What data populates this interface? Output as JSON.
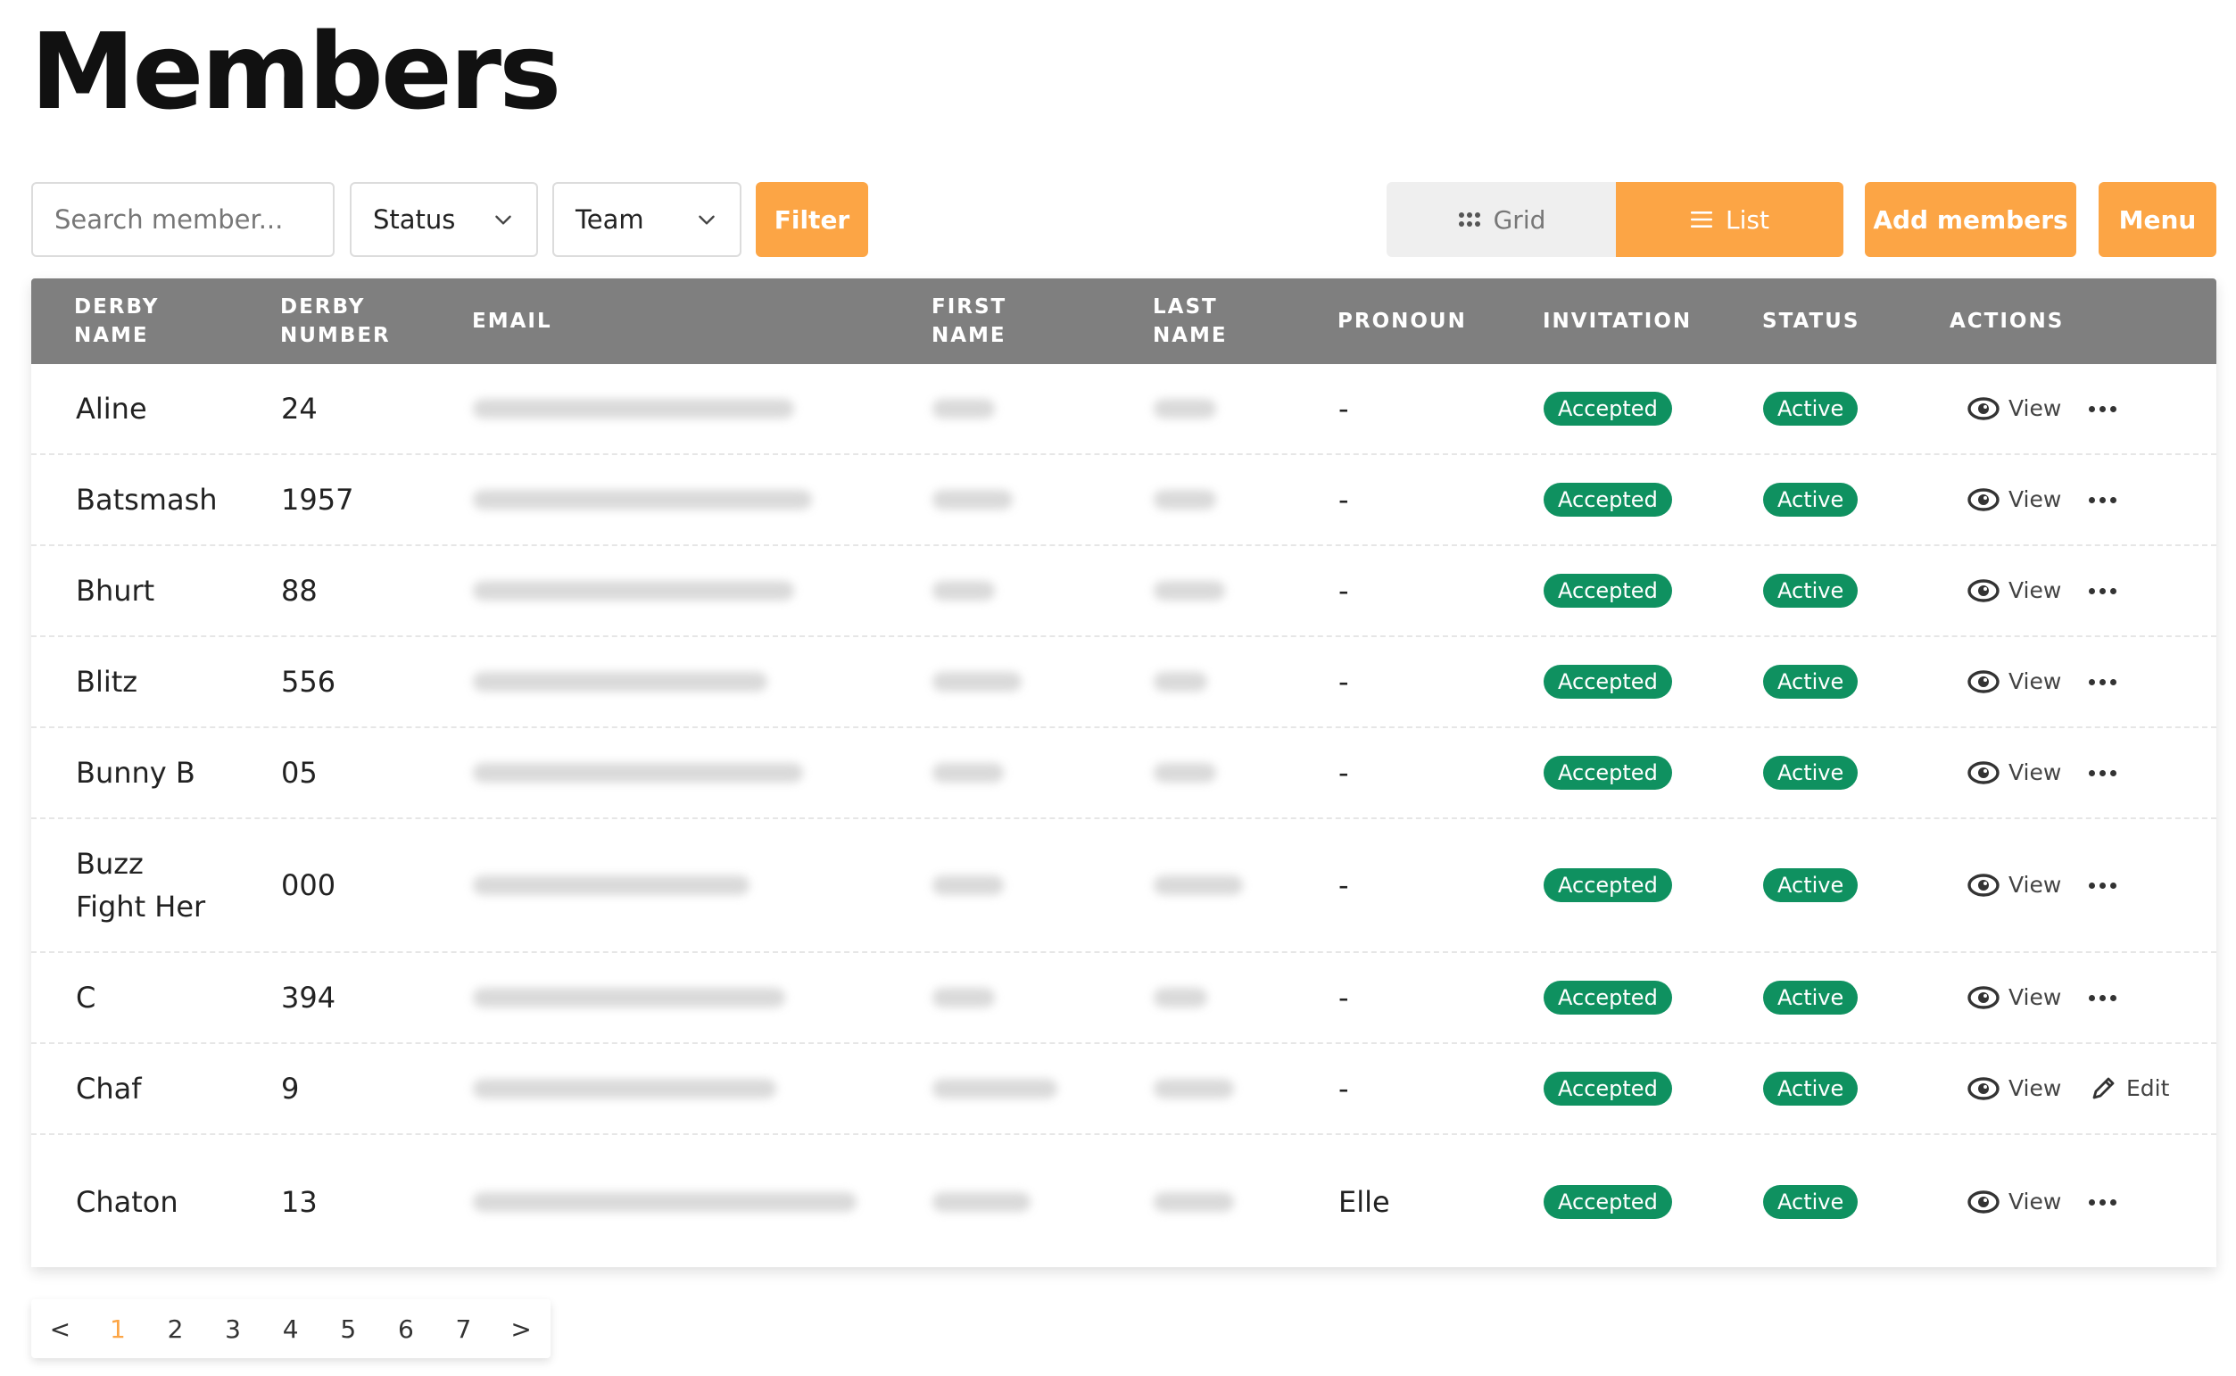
{
  "page": {
    "title": "Members"
  },
  "toolbar": {
    "search_placeholder": "Search member...",
    "status_select": "Status",
    "team_select": "Team",
    "filter_label": "Filter",
    "grid_label": "Grid",
    "list_label": "List",
    "add_members_label": "Add members",
    "menu_label": "Menu",
    "active_view": "List"
  },
  "table": {
    "headers": {
      "derby_name": "DERBY\nNAME",
      "derby_number": "DERBY\nNUMBER",
      "email": "EMAIL",
      "first_name": "FIRST\nNAME",
      "last_name": "LAST\nNAME",
      "pronoun": "PRONOUN",
      "invitation": "INVITATION",
      "status": "STATUS",
      "actions": "ACTIONS"
    },
    "rows": [
      {
        "derby_name": "Aline",
        "derby_number": "24",
        "pronoun": "-",
        "invitation": "Accepted",
        "status": "Active",
        "view_label": "View",
        "secondary": "more"
      },
      {
        "derby_name": "Batsmash",
        "derby_number": "1957",
        "pronoun": "-",
        "invitation": "Accepted",
        "status": "Active",
        "view_label": "View",
        "secondary": "more"
      },
      {
        "derby_name": "Bhurt",
        "derby_number": "88",
        "pronoun": "-",
        "invitation": "Accepted",
        "status": "Active",
        "view_label": "View",
        "secondary": "more"
      },
      {
        "derby_name": "Blitz",
        "derby_number": "556",
        "pronoun": "-",
        "invitation": "Accepted",
        "status": "Active",
        "view_label": "View",
        "secondary": "more"
      },
      {
        "derby_name": "Bunny B",
        "derby_number": "05",
        "pronoun": "-",
        "invitation": "Accepted",
        "status": "Active",
        "view_label": "View",
        "secondary": "more"
      },
      {
        "derby_name": "Buzz\nFight Her",
        "derby_number": "000",
        "pronoun": "-",
        "invitation": "Accepted",
        "status": "Active",
        "view_label": "View",
        "secondary": "more"
      },
      {
        "derby_name": "C",
        "derby_number": "394",
        "pronoun": "-",
        "invitation": "Accepted",
        "status": "Active",
        "view_label": "View",
        "secondary": "more"
      },
      {
        "derby_name": "Chaf",
        "derby_number": "9",
        "pronoun": "-",
        "invitation": "Accepted",
        "status": "Active",
        "view_label": "View",
        "secondary": "edit",
        "edit_label": "Edit"
      },
      {
        "derby_name": "Chaton",
        "derby_number": "13",
        "pronoun": "Elle",
        "invitation": "Accepted",
        "status": "Active",
        "view_label": "View",
        "secondary": "more"
      }
    ]
  },
  "pagination": {
    "prev": "<",
    "next": ">",
    "pages": [
      "1",
      "2",
      "3",
      "4",
      "5",
      "6",
      "7"
    ],
    "current": "1"
  },
  "colors": {
    "accent": "#fca545",
    "header_bg": "#7f7f7f",
    "badge_green": "#0f9160"
  }
}
